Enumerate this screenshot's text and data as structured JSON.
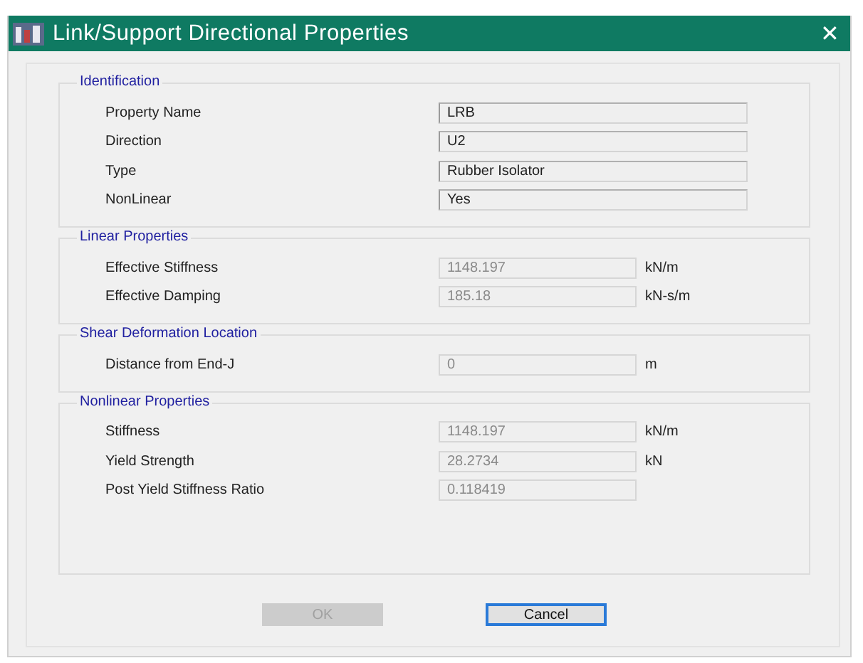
{
  "window": {
    "title": "Link/Support Directional Properties",
    "close": "✕"
  },
  "groups": [
    {
      "title": "Identification",
      "rows": [
        {
          "label": "Property Name",
          "value": "LRB",
          "disabled": false
        },
        {
          "label": "Direction",
          "value": "U2",
          "disabled": false
        },
        {
          "label": "Type",
          "value": "Rubber Isolator",
          "disabled": false
        },
        {
          "label": "NonLinear",
          "value": "Yes",
          "disabled": false
        }
      ]
    },
    {
      "title": "Linear Properties",
      "rows": [
        {
          "label": "Effective Stiffness",
          "value": "1148.197",
          "unit": "kN/m",
          "disabled": true
        },
        {
          "label": "Effective Damping",
          "value": "185.18",
          "unit": "kN-s/m",
          "disabled": true
        }
      ]
    },
    {
      "title": "Shear Deformation Location",
      "rows": [
        {
          "label": "Distance from End-J",
          "value": "0",
          "unit": "m",
          "disabled": true
        }
      ]
    },
    {
      "title": "Nonlinear Properties",
      "rows": [
        {
          "label": "Stiffness",
          "value": "1148.197",
          "unit": "kN/m",
          "disabled": true
        },
        {
          "label": "Yield Strength",
          "value": "28.2734",
          "unit": "kN",
          "disabled": true
        },
        {
          "label": "Post Yield Stiffness Ratio",
          "value": "0.118419",
          "disabled": true
        }
      ]
    }
  ],
  "buttons": [
    {
      "label": "OK",
      "disabled": true,
      "focused": false
    },
    {
      "label": "Cancel",
      "disabled": false,
      "focused": true
    }
  ]
}
